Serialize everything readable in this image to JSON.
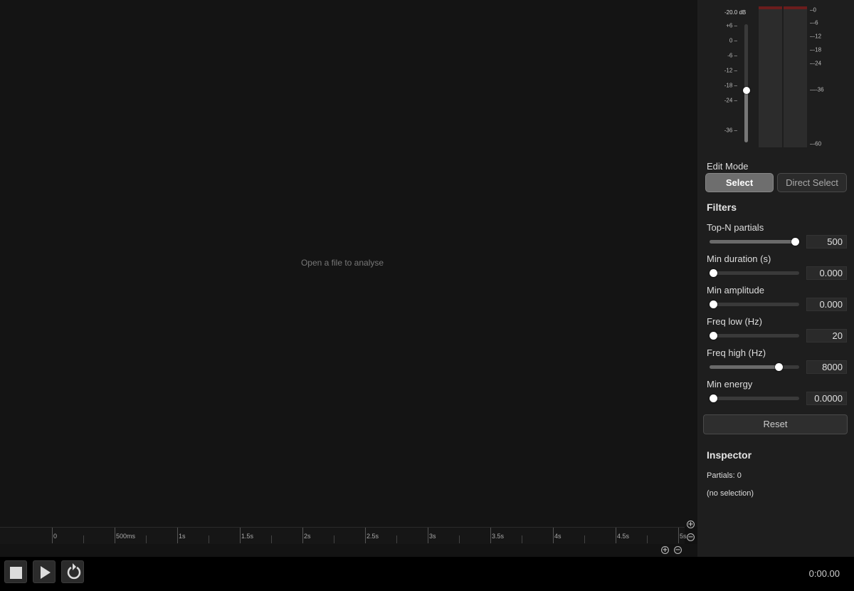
{
  "main": {
    "empty_message": "Open a file to analyse"
  },
  "ruler": {
    "ticks": [
      "0",
      "500ms",
      "1s",
      "1.5s",
      "2s",
      "2.5s",
      "3s",
      "3.5s",
      "4s",
      "4.5s",
      "5s"
    ],
    "zoom_in_symbol": "+",
    "zoom_out_symbol": "−"
  },
  "transport": {
    "stop_icon": "stop-icon",
    "play_icon": "play-icon",
    "loop_icon": "loop-icon",
    "time": "0:00.00"
  },
  "gain": {
    "readout": "-20.0 dB",
    "scale": [
      "+6 –",
      "0 –",
      "-6 –",
      "-12 –",
      "-18 –",
      "-24 –",
      "-36 –"
    ],
    "value_db": -20.0
  },
  "meters": {
    "scale": [
      "–0",
      "–-6",
      "–-12",
      "–-18",
      "–-24",
      "—-36",
      "–-60"
    ],
    "left_level": 0,
    "right_level": 0
  },
  "edit_mode": {
    "label": "Edit Mode",
    "select_label": "Select",
    "direct_select_label": "Direct Select",
    "active": "Select"
  },
  "filters": {
    "heading": "Filters",
    "items": [
      {
        "label": "Top-N partials",
        "value": "500",
        "fraction": 1.0
      },
      {
        "label": "Min duration (s)",
        "value": "0.000",
        "fraction": 0.0
      },
      {
        "label": "Min amplitude",
        "value": "0.000",
        "fraction": 0.0
      },
      {
        "label": "Freq low (Hz)",
        "value": "20",
        "fraction": 0.0
      },
      {
        "label": "Freq high (Hz)",
        "value": "8000",
        "fraction": 0.8
      },
      {
        "label": "Min energy",
        "value": "0.0000",
        "fraction": 0.0
      }
    ],
    "reset_label": "Reset"
  },
  "inspector": {
    "heading": "Inspector",
    "partials": "Partials: 0",
    "selection": "(no selection)"
  },
  "colors": {
    "background": "#111111",
    "panel": "#1e1e1e",
    "clip": "#6b1d1d"
  }
}
